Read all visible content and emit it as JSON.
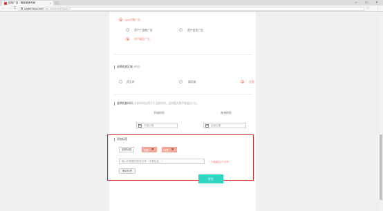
{
  "browser": {
    "tab_title": "招伐广告 · 精准营销专家",
    "tab_close": "×",
    "url_host": "center.bbcs.com",
    "url_path": "/ad_server/init?type=1",
    "back": "←",
    "forward": "→",
    "reload": "C",
    "star": "☆",
    "menu": "⋮",
    "minimize": "–",
    "maximize": "□",
    "close": "×"
  },
  "ad_type": {
    "group_label": "App内推广告",
    "options": [
      {
        "label": "资产广告推广告",
        "selected": false
      },
      {
        "label": "资产会员广告",
        "selected": false
      },
      {
        "label": "资产精品广告",
        "selected": true
      }
    ]
  },
  "region": {
    "title": "选择投放区域",
    "hint": "(单选)",
    "options": [
      {
        "label": "武汉市",
        "selected": false
      },
      {
        "label": "湖北省",
        "selected": false
      },
      {
        "label": "全国",
        "selected": true
      }
    ]
  },
  "time": {
    "title": "选择投放时间",
    "hint": "(开始时间必须大于当前时间，且间隔天数不能超过7天)",
    "start_label": "开始时间",
    "end_label": "结束时间",
    "start_placeholder": "开始日期",
    "end_placeholder": "结束日期"
  },
  "tags": {
    "title": "添加标签",
    "select_button": "选择标签",
    "selected_tags": [
      {
        "label": "标签"
      },
      {
        "label": "标签"
      }
    ],
    "tag_remove": "✕",
    "input_placeholder": "输入你想要的标签名称（不要包含，）",
    "limit_hint": "* 不能超过5个字符",
    "confirm_button": "确定标签"
  },
  "submit_label": "提交",
  "colors": {
    "accent": "#ef7b6a",
    "tag_bg": "#f4a89a",
    "submit_bg": "#2dd4c2",
    "highlight_frame": "#e02020"
  }
}
